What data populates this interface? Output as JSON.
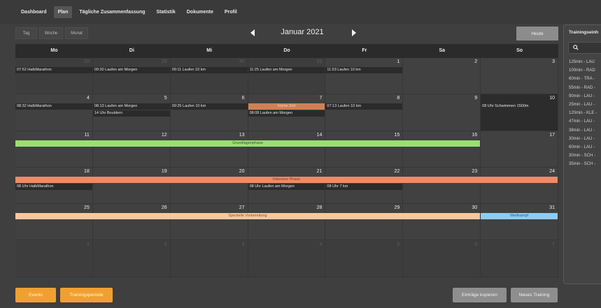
{
  "nav": [
    "Dashboard",
    "Plan",
    "Tägliche Zusammenfassung",
    "Statistik",
    "Dokumente",
    "Profil"
  ],
  "nav_active": "Plan",
  "toolbar": {
    "views": [
      "Tag",
      "Woche",
      "Monat"
    ],
    "month": "Januar 2021",
    "today": "Heute"
  },
  "weekdays": [
    "Mo",
    "Di",
    "Mi",
    "Do",
    "Fr",
    "Sa",
    "So"
  ],
  "weeks": [
    {
      "days": [
        {
          "n": "28",
          "other": true
        },
        {
          "n": "29",
          "other": true
        },
        {
          "n": "30",
          "other": true
        },
        {
          "n": "31",
          "other": true
        },
        {
          "n": "1"
        },
        {
          "n": "2"
        },
        {
          "n": "3"
        }
      ],
      "events": [
        {
          "col": 0,
          "row": 0,
          "text": "07:52 HalbMarathon"
        },
        {
          "col": 1,
          "row": 0,
          "text": "09:20 Laufen am Morgen"
        },
        {
          "col": 2,
          "row": 0,
          "text": "09:11 Laufen 10 km"
        },
        {
          "col": 3,
          "row": 0,
          "text": "11:25 Laufen am Morgen"
        },
        {
          "col": 4,
          "row": 0,
          "text": "11:53 Laufen 10 km"
        }
      ]
    },
    {
      "days": [
        {
          "n": "4"
        },
        {
          "n": "5"
        },
        {
          "n": "6"
        },
        {
          "n": "7"
        },
        {
          "n": "8"
        },
        {
          "n": "9"
        },
        {
          "n": "10",
          "hl": true
        }
      ],
      "events": [
        {
          "col": 0,
          "row": 0,
          "text": "08:32 HalbMarathon"
        },
        {
          "col": 1,
          "row": 0,
          "text": "08:13 Laufen am Morgen"
        },
        {
          "col": 1,
          "row": 1,
          "text": "14 Uhr Bouldern"
        },
        {
          "col": 2,
          "row": 0,
          "text": "09:25 Laufen 10 km"
        },
        {
          "col": 3,
          "row": 0,
          "text": "Home Zeit",
          "orange": true
        },
        {
          "col": 3,
          "row": 1,
          "text": "08:08 Laufen am Morgen"
        },
        {
          "col": 4,
          "row": 0,
          "text": "07:13 Laufen 10 km"
        },
        {
          "col": 6,
          "row": 0,
          "text": "08 Uhr Schwimmen 1500m",
          "hl": true
        }
      ]
    },
    {
      "days": [
        {
          "n": "11"
        },
        {
          "n": "12"
        },
        {
          "n": "13"
        },
        {
          "n": "14"
        },
        {
          "n": "15"
        },
        {
          "n": "16"
        },
        {
          "n": "17"
        }
      ],
      "events": [],
      "phases": [
        {
          "start": 0,
          "span": 6,
          "label": "Grundlagenphase",
          "color": "green"
        }
      ]
    },
    {
      "days": [
        {
          "n": "18"
        },
        {
          "n": "19"
        },
        {
          "n": "20"
        },
        {
          "n": "21"
        },
        {
          "n": "22"
        },
        {
          "n": "23"
        },
        {
          "n": "24"
        }
      ],
      "events": [
        {
          "col": 0,
          "row": 1,
          "text": "08 Uhr HalbMarathon"
        },
        {
          "col": 3,
          "row": 1,
          "text": "08 Uhr Laufen am Morgen"
        },
        {
          "col": 4,
          "row": 1,
          "text": "08 Uhr 7 km"
        }
      ],
      "phases": [
        {
          "start": 0,
          "span": 7,
          "label": "Intensive Phase",
          "color": "salmon"
        }
      ]
    },
    {
      "days": [
        {
          "n": "25"
        },
        {
          "n": "26"
        },
        {
          "n": "27"
        },
        {
          "n": "28"
        },
        {
          "n": "29"
        },
        {
          "n": "30"
        },
        {
          "n": "31"
        }
      ],
      "events": [],
      "phases": [
        {
          "start": 0,
          "span": 6,
          "label": "Spezielle Vorbereitung",
          "color": "peach"
        },
        {
          "start": 6,
          "span": 1,
          "label": "Wettkampf",
          "color": "blue"
        }
      ]
    },
    {
      "days": [
        {
          "n": "1",
          "other": true
        },
        {
          "n": "2",
          "other": true
        },
        {
          "n": "3",
          "other": true
        },
        {
          "n": "4",
          "other": true
        },
        {
          "n": "5",
          "other": true
        },
        {
          "n": "6",
          "other": true
        },
        {
          "n": "7",
          "other": true
        }
      ],
      "events": []
    }
  ],
  "buttons": {
    "events": "Events",
    "period": "Trainingsperiode",
    "copy": "Einträge kopieren",
    "new": "Neues Training"
  },
  "sidepanel": {
    "title": "Trainingseinh",
    "items": [
      "125min - LAU",
      "100min - RAD",
      "60min - TRA -",
      "55min - RAD -",
      "90min - LAU -",
      "25min - LAU -",
      "120min - KLE -",
      "47min - LAU -",
      "38min - LAU -",
      "30min - LAU -",
      "60min - LAU -",
      "30min - SCH -",
      "35min - SCH -"
    ]
  }
}
